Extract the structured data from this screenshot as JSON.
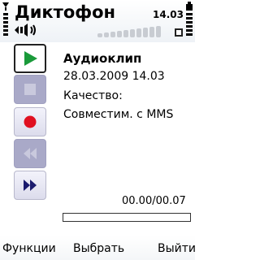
{
  "header": {
    "title": "Диктофон",
    "time": "14.03"
  },
  "controls": [
    {
      "name": "play",
      "state": "selected"
    },
    {
      "name": "stop",
      "state": "disabled"
    },
    {
      "name": "record",
      "state": "enabled"
    },
    {
      "name": "rewind",
      "state": "disabled"
    },
    {
      "name": "fast-forward",
      "state": "enabled"
    }
  ],
  "clip": {
    "name": "Аудиоклип",
    "datetime": "28.03.2009 14.03",
    "quality_label": "Качество:",
    "quality_value": "Совместим. с MMS"
  },
  "playback": {
    "time": "00.00/00.07",
    "progress": 0
  },
  "softkeys": {
    "left": "Функции",
    "middle": "Выбрать",
    "right": "Выйти"
  },
  "colors": {
    "play_green": "#1a9a3a",
    "record_red": "#e01020",
    "control_blue": "#1b1b6e",
    "disabled_control": "#a9a9c8"
  }
}
